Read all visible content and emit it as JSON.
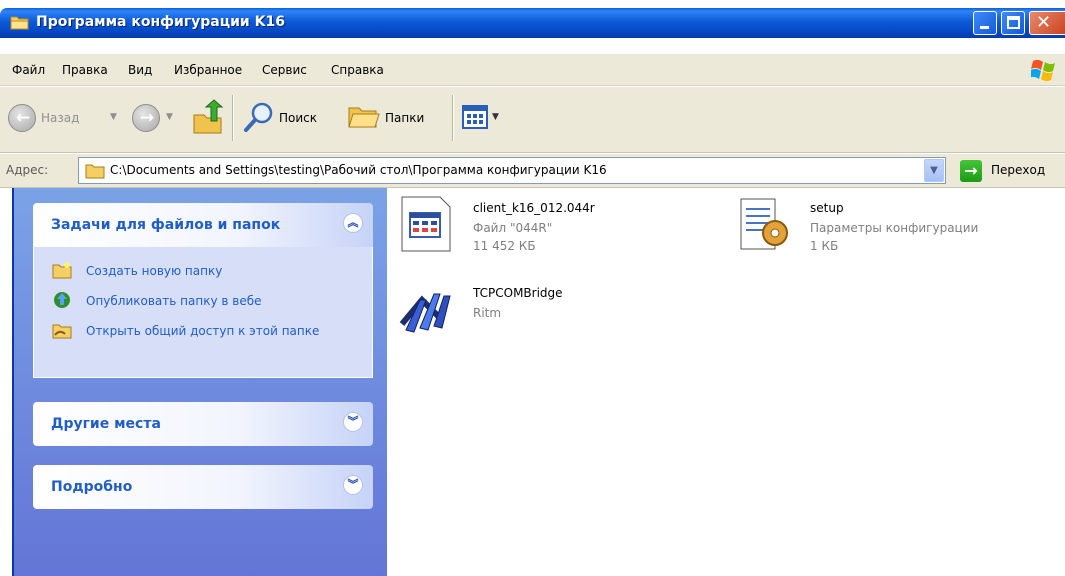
{
  "window": {
    "title": "Программа конфигурации K16"
  },
  "menu": [
    "Файл",
    "Правка",
    "Вид",
    "Избранное",
    "Сервис",
    "Справка"
  ],
  "toolbar": {
    "back_label": "Назад",
    "search_label": "Поиск",
    "folders_label": "Папки"
  },
  "address": {
    "label": "Адрес:",
    "value": "C:\\Documents and Settings\\testing\\Рабочий стол\\Программа конфигурации K16",
    "go_label": "Переход"
  },
  "sidebar": {
    "tasks_title": "Задачи для файлов и папок",
    "tasks": [
      {
        "label": "Создать новую папку"
      },
      {
        "label": "Опубликовать папку в вебе"
      },
      {
        "label": "Открыть общий доступ к этой папке"
      }
    ],
    "other_places_title": "Другие места",
    "details_title": "Подробно"
  },
  "files": [
    {
      "name": "client_k16_012.044r",
      "type": "Файл \"044R\"",
      "size": "11 452 КБ"
    },
    {
      "name": "setup",
      "type": "Параметры конфигурации",
      "size": "1 КБ"
    },
    {
      "name": "TCPCOMBridge",
      "type": "Ritm",
      "size": ""
    }
  ],
  "colors": {
    "titlebar": "#0548c4",
    "sidebar_gradient_top": "#7ba2e7",
    "sidebar_gradient_bottom": "#6375d6",
    "task_link": "#215dc6"
  }
}
